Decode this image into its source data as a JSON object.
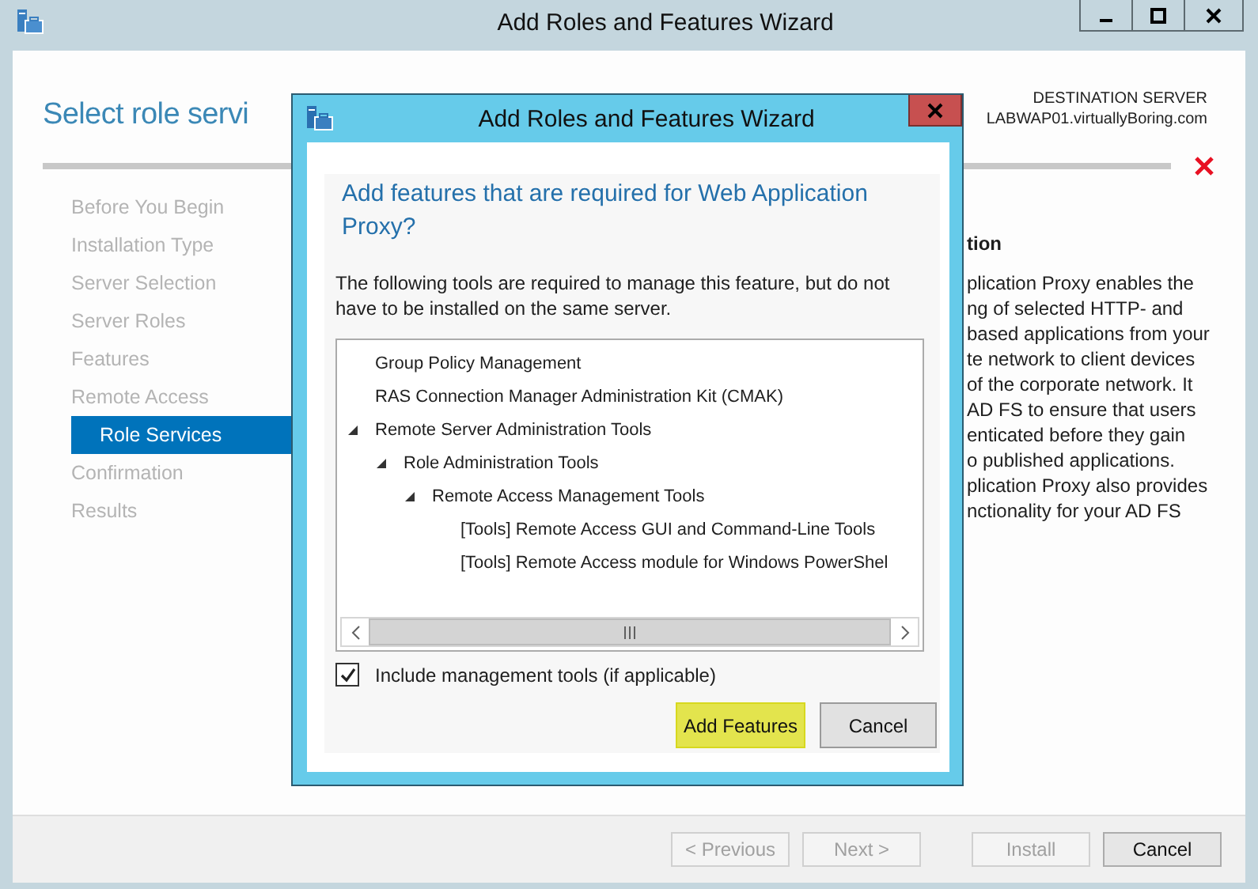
{
  "window": {
    "title": "Add Roles and Features Wizard"
  },
  "page": {
    "title": "Select role servi",
    "destination_label": "DESTINATION SERVER",
    "destination_server": "LABWAP01.virtuallyBoring.com"
  },
  "steps": [
    {
      "label": "Before You Begin",
      "selected": false
    },
    {
      "label": "Installation Type",
      "selected": false
    },
    {
      "label": "Server Selection",
      "selected": false
    },
    {
      "label": "Server Roles",
      "selected": false
    },
    {
      "label": "Features",
      "selected": false
    },
    {
      "label": "Remote Access",
      "selected": false
    },
    {
      "label": "Role Services",
      "selected": true
    },
    {
      "label": "Confirmation",
      "selected": false
    },
    {
      "label": "Results",
      "selected": false
    }
  ],
  "description": {
    "heading": "tion",
    "lines": [
      "plication Proxy enables the",
      "ng of selected HTTP- and",
      "based applications from your",
      "te network to client devices",
      "of the corporate network. It",
      "AD FS to ensure that users",
      "enticated before they gain",
      "o published applications.",
      "plication Proxy also provides",
      "nctionality for your AD FS"
    ]
  },
  "footer_buttons": [
    {
      "label": "< Previous",
      "disabled": true
    },
    {
      "label": "Next >",
      "disabled": true
    },
    {
      "label": "Install",
      "disabled": true
    },
    {
      "label": "Cancel",
      "disabled": false
    }
  ],
  "dialog": {
    "title": "Add Roles and Features Wizard",
    "heading": "Add features that are required for Web Application Proxy?",
    "text": "The following tools are required to manage this feature, but do not have to be installed on the same server.",
    "tree": [
      {
        "label": "Group Policy Management"
      },
      {
        "label": "RAS Connection Manager Administration Kit (CMAK)"
      },
      {
        "label": "Remote Server Administration Tools",
        "expanded": true,
        "children": [
          {
            "label": "Role Administration Tools",
            "expanded": true,
            "children": [
              {
                "label": "Remote Access Management Tools",
                "expanded": true,
                "children": [
                  {
                    "label": "[Tools] Remote Access GUI and Command-Line Tools"
                  },
                  {
                    "label": "[Tools] Remote Access module for Windows PowerShel"
                  }
                ]
              }
            ]
          }
        ]
      }
    ],
    "include_tools": {
      "label": "Include management tools (if applicable)",
      "checked": true
    },
    "buttons": [
      {
        "label": "Add Features",
        "default": true
      },
      {
        "label": "Cancel",
        "default": false
      }
    ]
  }
}
